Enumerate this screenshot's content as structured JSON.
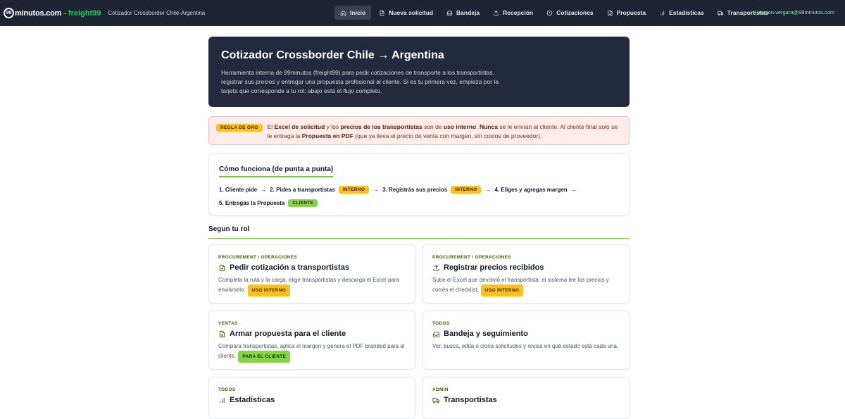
{
  "brand": {
    "logo_num": "99",
    "logo_text": "minutos.com",
    "dash": "-",
    "freight": "freight99",
    "subtitle": "Cotizador Crossborder Chile-Argentina"
  },
  "nav": {
    "items": [
      {
        "label": "Inicio",
        "icon": "home-icon",
        "active": true
      },
      {
        "label": "Nueva solicitud",
        "icon": "file-plus-icon"
      },
      {
        "label": "Bandeja",
        "icon": "inbox-icon"
      },
      {
        "label": "Recepción",
        "icon": "upload-icon"
      },
      {
        "label": "Cotizaciones",
        "icon": "clock-icon"
      },
      {
        "label": "Propuesta",
        "icon": "document-icon"
      },
      {
        "label": "Estadísticas",
        "icon": "bar-chart-icon"
      },
      {
        "label": "Transportistas",
        "icon": "truck-icon"
      }
    ],
    "user": "ramon.vergara@99minutos.com"
  },
  "hero": {
    "title": "Cotizador Crossborder Chile → Argentina",
    "desc": "Herramienta interna de 99minutos (freight99) para pedir cotizaciones de transporte a los transportistas, registrar sus precios y entregar una propuesta profesional al cliente. Si es tu primera vez, empieza por la tarjeta que corresponde a tu rol; abajo está el flujo completo."
  },
  "rule": {
    "badge": "REGLA DE ORO",
    "t1": "El ",
    "b1": "Excel de solicitud",
    "t2": " y los ",
    "b2": "precios de los transportistas",
    "t3": " son de ",
    "b3": "uso interno",
    "t4": ". ",
    "b4": "Nunca",
    "t5": " se le envían al cliente. Al cliente final solo se le entrega la ",
    "b5": "Propuesta en PDF",
    "t6": " (que ya lleva el precio de venta con margen, sin costos de proveedor)."
  },
  "howto": {
    "title": "Cómo funciona (de punta a punta)",
    "step1": "1. Cliente pide",
    "step2": "2. Pides a transportistas",
    "step3": "3. Registrás sus precios",
    "step4": "4. Eliges y agregas margen",
    "step5": "5. Entregás la Propuesta",
    "arrow": "→",
    "badge_internal": "INTERNO",
    "badge_client": "CLIENTE"
  },
  "section_role": "Segun tu rol",
  "cards": [
    {
      "tag": "PROCUREMENT / OPERACIONES",
      "title": "Pedir cotización a transportistas",
      "desc": "Completa la ruta y la carga, elige transportistas y descarga el Excel para enviárselo.",
      "badge": "USO INTERNO",
      "icon": "file-plus-icon"
    },
    {
      "tag": "PROCUREMENT / OPERACIONES",
      "title": "Registrar precios recibidos",
      "desc": "Sube el Excel que devolvió el transportista: el sistema lee los precios y corrés el checklist.",
      "badge": "USO INTERNO",
      "icon": "upload-icon"
    },
    {
      "tag": "VENTAS",
      "title": "Armar propuesta para el cliente",
      "desc": "Compara transportistas, aplica el margen y genera el PDF branded para el cliente.",
      "badge": "PARA EL CLIENTE",
      "icon": "document-icon"
    },
    {
      "tag": "TODOS",
      "title": "Bandeja y seguimiento",
      "desc": "Ver, busca, edita o clona solicitudes y revisa en qué estado está cada una.",
      "badge": "",
      "icon": "inbox-icon"
    },
    {
      "tag": "TODOS",
      "title": "Estadísticas",
      "desc": "",
      "badge": "",
      "icon": "bar-chart-icon"
    },
    {
      "tag": "ADMIN",
      "title": "Transportistas",
      "desc": "",
      "badge": "",
      "icon": "truck-icon"
    }
  ]
}
